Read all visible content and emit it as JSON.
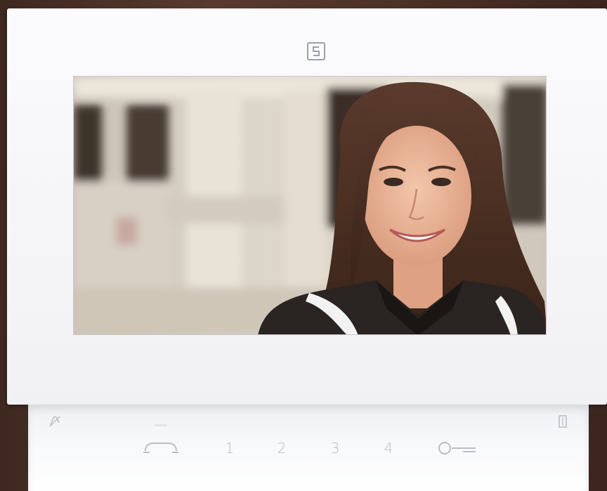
{
  "device": {
    "brand_logo_letter": "S",
    "camera_feed": "visitor-video",
    "accent_color": "#b9bec6",
    "frame_color": "#f4f4f6"
  },
  "keypad": {
    "mute_icon": "bell-mute-icon",
    "handset_icon": "handset-icon",
    "key_1": "1",
    "key_2": "2",
    "key_3": "3",
    "key_4": "4",
    "door_key_icon": "key-icon",
    "door_icon": "door-icon"
  }
}
